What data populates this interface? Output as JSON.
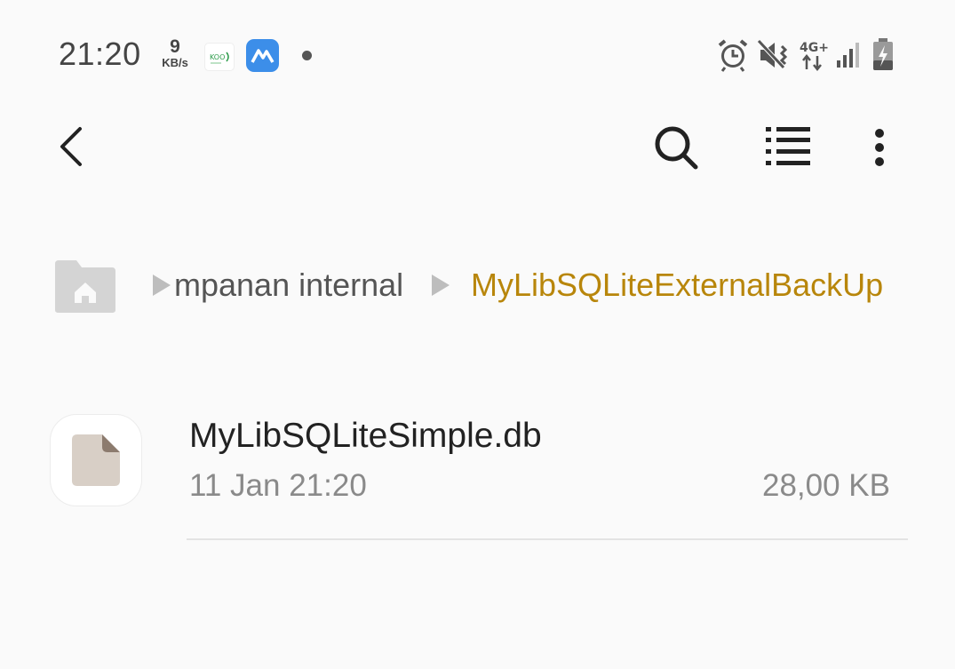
{
  "status_bar": {
    "time": "21:20",
    "net_speed_value": "9",
    "net_speed_unit": "KB/s",
    "icons": [
      "koo-app-icon",
      "blue-app-icon",
      "notification-dot",
      "alarm-icon",
      "mute-icon",
      "4g-plus-icon",
      "signal-icon",
      "battery-charging-icon"
    ],
    "network_label": "4G+"
  },
  "toolbar": {
    "back": "back-icon",
    "search": "search-icon",
    "list_view": "list-view-icon",
    "more": "more-options-icon"
  },
  "breadcrumb": {
    "home_icon": "home-folder-icon",
    "items": [
      {
        "label": "mpanan internal"
      },
      {
        "label": "MyLibSQLiteExternalBackUp"
      }
    ],
    "active_color": "#b8860b"
  },
  "files": [
    {
      "name": "MyLibSQLiteSimple.db",
      "date": "11 Jan 21:20",
      "size": "28,00 KB",
      "icon": "file-icon"
    }
  ]
}
